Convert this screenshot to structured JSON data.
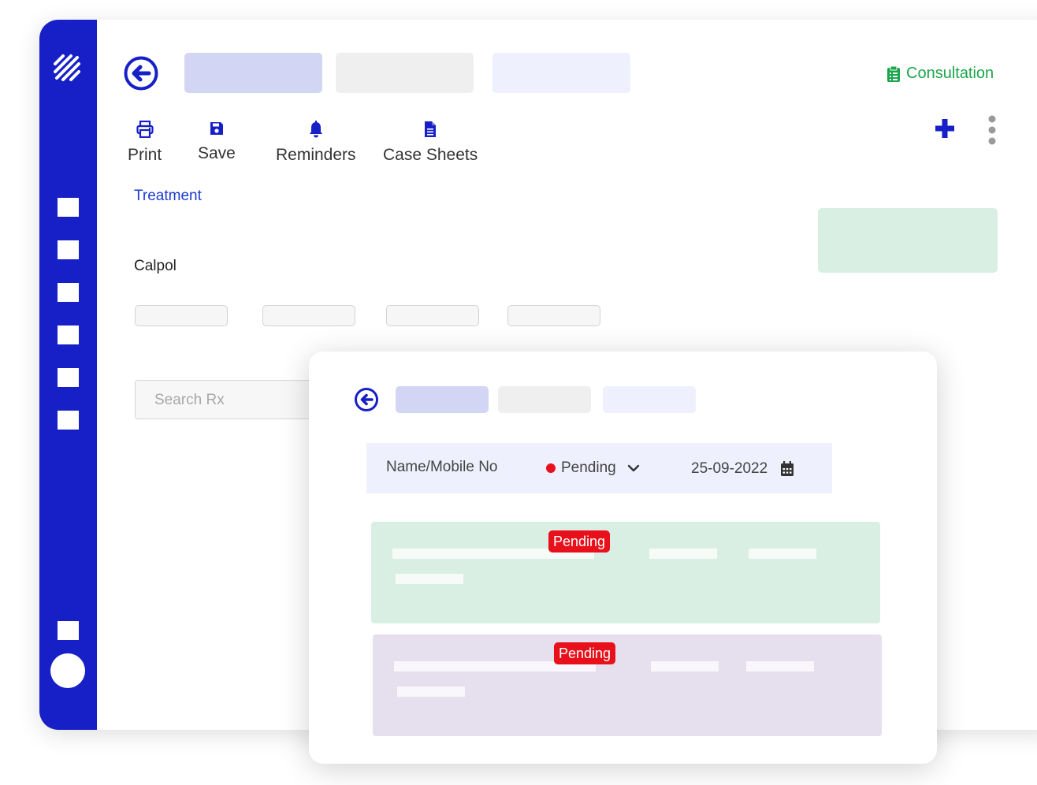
{
  "header": {
    "consultation_label": "Consultation"
  },
  "toolbar": {
    "print": "Print",
    "save": "Save",
    "reminders": "Reminders",
    "case_sheets": "Case Sheets"
  },
  "content": {
    "section_title": "Treatment",
    "medicine": "Calpol",
    "search_placeholder": "Search Rx"
  },
  "modal": {
    "filter": {
      "name_label": "Name/Mobile No",
      "status": "Pending",
      "date": "25-09-2022"
    },
    "cards": [
      {
        "badge": "Pending"
      },
      {
        "badge": "Pending"
      }
    ]
  },
  "colors": {
    "sidebar": "#1620c6",
    "accent": "#1b3bd1",
    "consultation": "#1aa64a",
    "pending": "#e8101b",
    "card_green": "#d9efe4",
    "card_purple": "#e6dfee"
  },
  "icons": {
    "logo": "striped-logo-icon",
    "back": "arrow-left-circle-icon",
    "consultation": "clipboard-icon",
    "print": "printer-icon",
    "save": "floppy-disk-icon",
    "reminders": "bell-icon",
    "case_sheets": "document-icon",
    "add": "plus-icon",
    "more": "vertical-dots-icon",
    "dropdown": "chevron-down-icon",
    "date": "calendar-icon"
  }
}
